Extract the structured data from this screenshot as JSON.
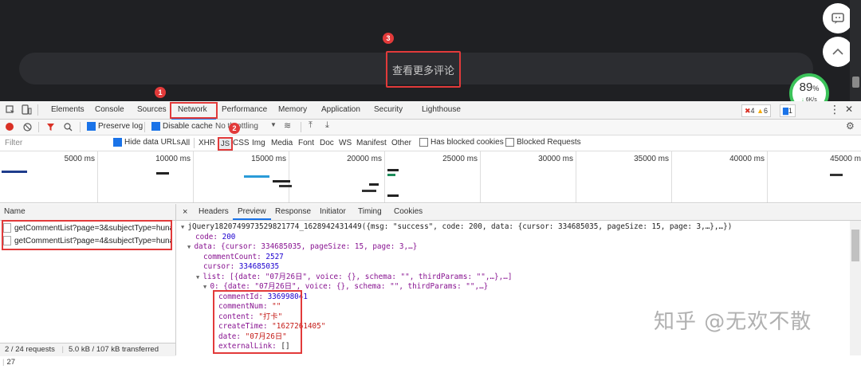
{
  "page": {
    "more_comments": "查看更多评论",
    "speed_value": "89",
    "speed_unit": "%",
    "speed_rate": "6K/s"
  },
  "callouts": [
    "1",
    "2",
    "3"
  ],
  "devtools": {
    "tabs": [
      "Elements",
      "Console",
      "Sources",
      "Network",
      "Performance",
      "Memory",
      "Application",
      "Security",
      "Lighthouse"
    ],
    "errors": "4",
    "warnings": "6",
    "messages": "1"
  },
  "network": {
    "preserve_log": "Preserve log",
    "disable_cache": "Disable cache",
    "throttling": "No throttling"
  },
  "filter": {
    "placeholder": "Filter",
    "hide_data_urls": "Hide data URLs",
    "types": [
      "All",
      "XHR",
      "JS",
      "CSS",
      "Img",
      "Media",
      "Font",
      "Doc",
      "WS",
      "Manifest",
      "Other"
    ],
    "blocked_cookies": "Has blocked cookies",
    "blocked_requests": "Blocked Requests"
  },
  "timeline": {
    "ticks": [
      "5000 ms",
      "10000 ms",
      "15000 ms",
      "20000 ms",
      "25000 ms",
      "30000 ms",
      "35000 ms",
      "40000 ms",
      "45000 m"
    ]
  },
  "requests": {
    "header": "Name",
    "items": [
      "getCommentList?page=3&subjectType=huna...",
      "getCommentList?page=4&subjectType=huna..."
    ],
    "status": "2 / 24 requests",
    "transferred": "5.0 kB / 107 kB transferred",
    "extra": "27"
  },
  "detail": {
    "tabs": [
      "Headers",
      "Preview",
      "Response",
      "Initiator",
      "Timing",
      "Cookies"
    ],
    "close": "×"
  },
  "preview": {
    "root": "jQuery1820749973529821774_1628942431449({msg: \"success\", code: 200, data: {cursor: 334685035, pageSize: 15, page: 3,…},…})",
    "code_key": "code: ",
    "code_val": "200",
    "data_line": "data: {cursor: 334685035, pageSize: 15, page: 3,…}",
    "comment_count_key": "commentCount: ",
    "comment_count_val": "2527",
    "cursor_key": "cursor: ",
    "cursor_val": "334685035",
    "list_line": "list: [{date: \"07月26日\", voice: {}, schema: \"\", thirdParams: \"\",…},…]",
    "item0_line": "0: {date: \"07月26日\", voice: {}, schema: \"\", thirdParams: \"\",…}",
    "comment_id_key": "commentId: ",
    "comment_id_val": "336998041",
    "comment_num_key": "commentNum: ",
    "comment_num_val": "\"\"",
    "content_key": "content: ",
    "content_val": "\"打卡\"",
    "create_time_key": "createTime: ",
    "create_time_val": "\"1627261405\"",
    "date_key": "date: ",
    "date_val": "\"07月26日\"",
    "external_link_key": "externalLink: ",
    "external_link_val": "[]"
  },
  "watermark": "知乎 @无欢不散",
  "colors": {
    "accent_red": "#e23a3a",
    "devtools_blue": "#1a73e8",
    "speed_green": "#3cc35a"
  }
}
